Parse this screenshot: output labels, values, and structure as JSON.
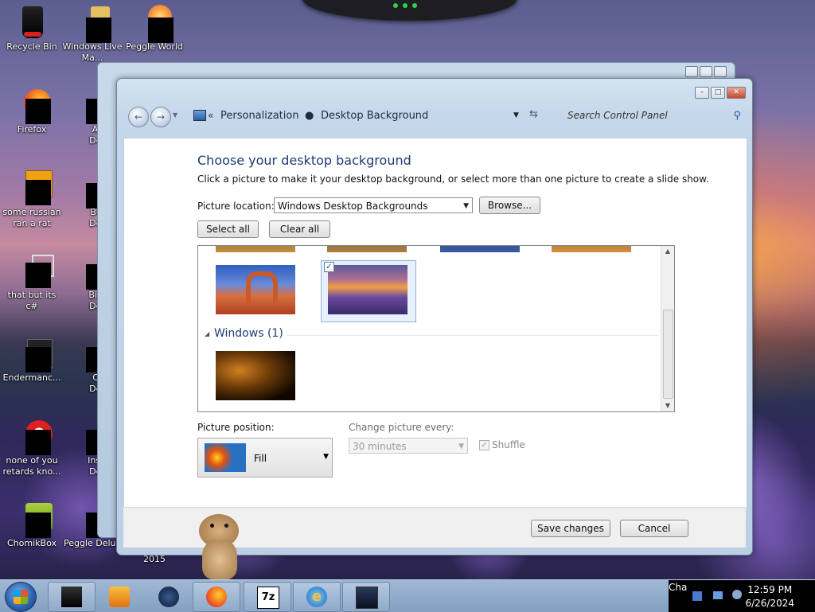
{
  "desktop": {
    "icons": [
      {
        "label": "Recycle Bin"
      },
      {
        "label": "Windows Live Ma..."
      },
      {
        "label": "Peggle World"
      },
      {
        "label": "Firefox"
      },
      {
        "label": "Astro Delu..."
      },
      {
        "label": "some russian ran a rat"
      },
      {
        "label": "Bejew Delu..."
      },
      {
        "label": "that but its c#"
      },
      {
        "label": "Big Mo Delu..."
      },
      {
        "label": "Endermanc..."
      },
      {
        "label": "Chuz Delu..."
      },
      {
        "label": "none of you retards kno..."
      },
      {
        "label": "Insaniq Delu..."
      },
      {
        "label": "ChomikBox"
      },
      {
        "label": "Peggle Delux"
      },
      {
        "label": "2015"
      }
    ]
  },
  "window": {
    "breadcrumb": [
      "Personalization",
      "Desktop Background"
    ],
    "search_placeholder": "Search Control Panel",
    "heading": "Choose your desktop background",
    "description": "Click a picture to make it your desktop background, or select more than one picture to create a slide show.",
    "picture_location_label": "Picture location:",
    "picture_location_value": "Windows Desktop Backgrounds",
    "browse_label": "Browse...",
    "select_all_label": "Select all",
    "clear_all_label": "Clear all",
    "group_label": "Windows (1)",
    "picture_position_label": "Picture position:",
    "picture_position_value": "Fill",
    "change_every_label": "Change picture every:",
    "change_every_value": "30 minutes",
    "shuffle_label": "Shuffle",
    "save_label": "Save changes",
    "cancel_label": "Cancel"
  },
  "taskbar": {
    "tray_text": "Cha",
    "time": "12:59 PM",
    "date": "6/26/2024"
  }
}
